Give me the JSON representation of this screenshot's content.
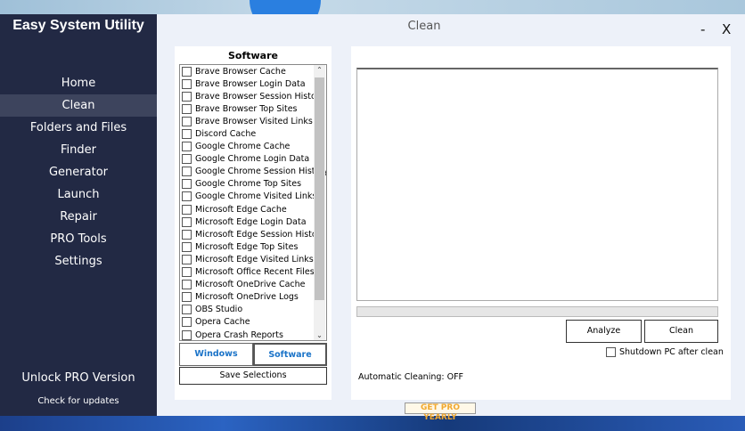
{
  "app": {
    "title": "Easy System Utility",
    "page_title": "Clean",
    "minimize": "-",
    "close": "X"
  },
  "sidebar": {
    "items": [
      {
        "label": "Home"
      },
      {
        "label": "Clean"
      },
      {
        "label": "Folders and Files"
      },
      {
        "label": "Finder"
      },
      {
        "label": "Generator"
      },
      {
        "label": "Launch"
      },
      {
        "label": "Repair"
      },
      {
        "label": "PRO Tools"
      },
      {
        "label": "Settings"
      }
    ],
    "unlock": "Unlock PRO Version",
    "updates": "Check for updates"
  },
  "software": {
    "title": "Software",
    "items": [
      "Brave Browser Cache",
      "Brave Browser Login Data",
      "Brave Browser Session History",
      "Brave Browser Top Sites",
      "Brave Browser Visited Links",
      "Discord Cache",
      "Google Chrome Cache",
      "Google Chrome Login Data",
      "Google Chrome Session History",
      "Google Chrome Top Sites",
      "Google Chrome Visited Links",
      "Microsoft Edge Cache",
      "Microsoft Edge Login Data",
      "Microsoft Edge Session History",
      "Microsoft Edge Top Sites",
      "Microsoft Edge Visited Links",
      "Microsoft Office Recent Files",
      "Microsoft OneDrive Cache",
      "Microsoft OneDrive Logs",
      "OBS Studio",
      "Opera Cache",
      "Opera Crash Reports"
    ],
    "tab_windows": "Windows",
    "tab_software": "Software",
    "save": "Save Selections"
  },
  "main": {
    "analyze": "Analyze",
    "clean": "Clean",
    "shutdown": "Shutdown PC after clean",
    "auto": "Automatic Cleaning: OFF",
    "progress": 0,
    "pro": "GET PRO YEARLY"
  }
}
